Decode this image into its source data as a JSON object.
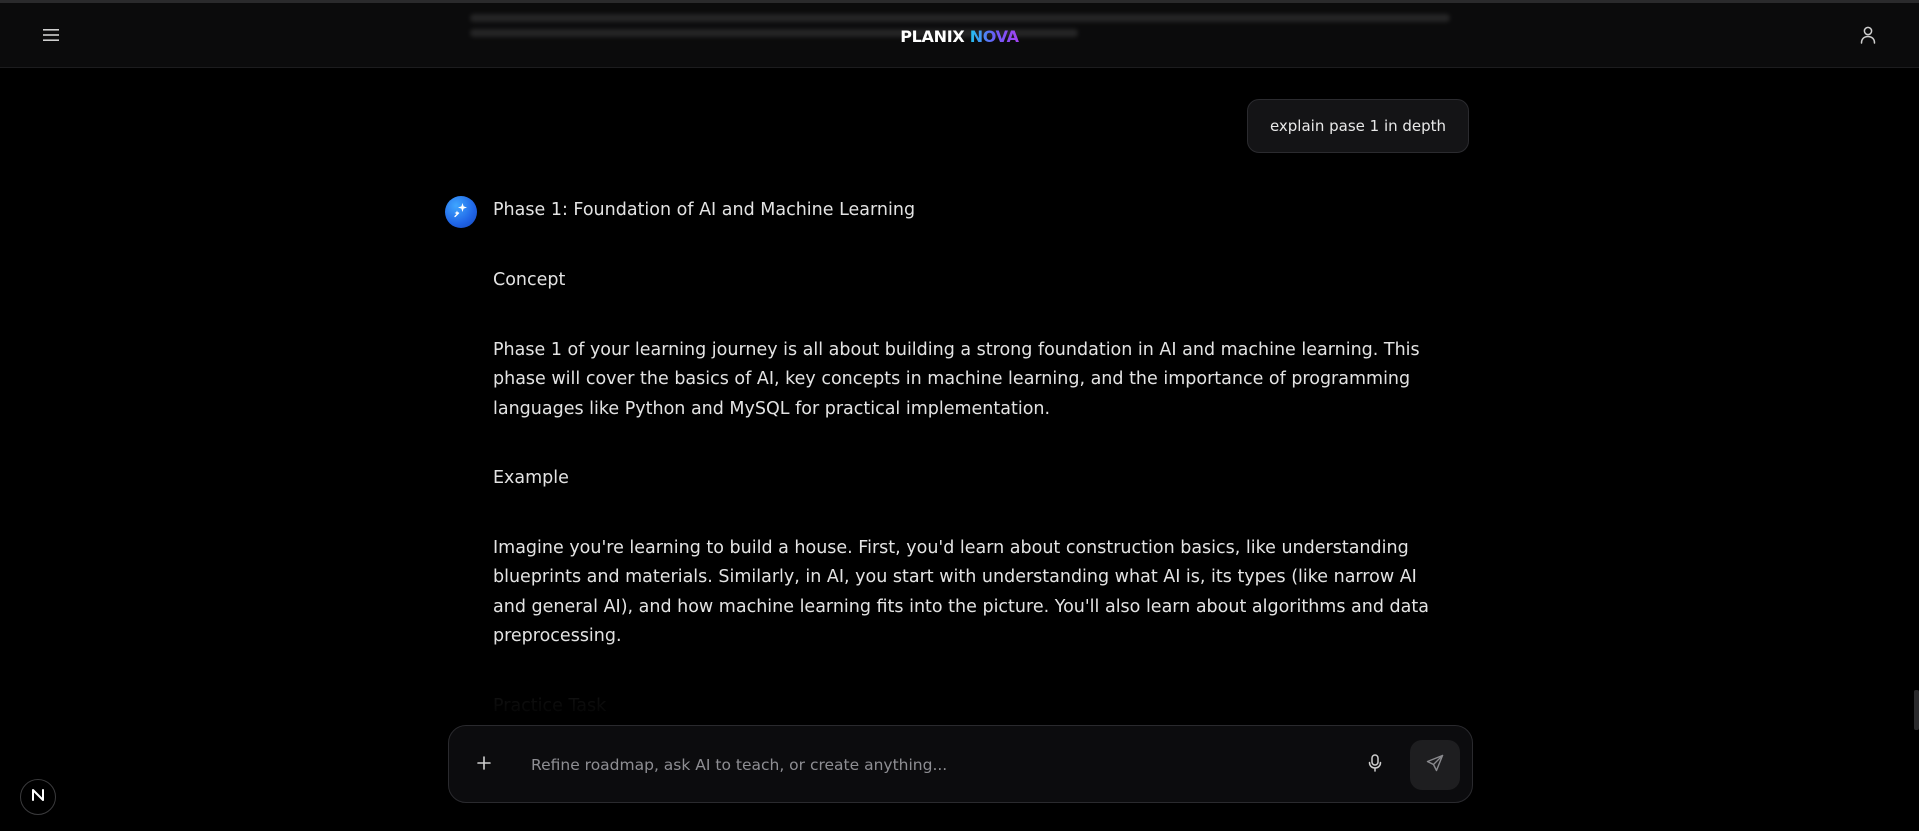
{
  "header": {
    "brand_part_1": "PLANIX ",
    "brand_part_2": "NOVA",
    "menu_icon": "hamburger-menu-icon",
    "user_icon": "user-icon"
  },
  "conversation": {
    "user_message": "explain pase 1 in depth",
    "assistant": {
      "avatar_icon": "sparkle-icon",
      "heading": "Phase 1: Foundation of AI and Machine Learning",
      "concept_title": "Concept",
      "concept_body": "Phase 1 of your learning journey is all about building a strong foundation in AI and machine learning. This phase will cover the basics of AI, key concepts in machine learning, and the importance of programming languages like Python and MySQL for practical implementation.",
      "example_title": "Example",
      "example_body": "Imagine you're learning to build a house. First, you'd learn about construction basics, like understanding blueprints and materials. Similarly, in AI, you start with understanding what AI is, its types (like narrow AI and general AI), and how machine learning fits into the picture. You'll also learn about algorithms and data preprocessing.",
      "practice_title": "Practice Task"
    }
  },
  "composer": {
    "placeholder": "Refine roadmap, ask AI to teach, or create anything...",
    "value": "",
    "plus_icon": "plus-icon",
    "mic_icon": "microphone-icon",
    "send_icon": "send-icon"
  },
  "badge": {
    "letter": "N"
  },
  "colors": {
    "background": "#000000",
    "header_bg": "#0b0b0c",
    "brand_gradient_start": "#22c3f0",
    "brand_gradient_end": "#a541f2",
    "avatar_blue": "#1f64e6",
    "bubble_bg": "#141416"
  }
}
